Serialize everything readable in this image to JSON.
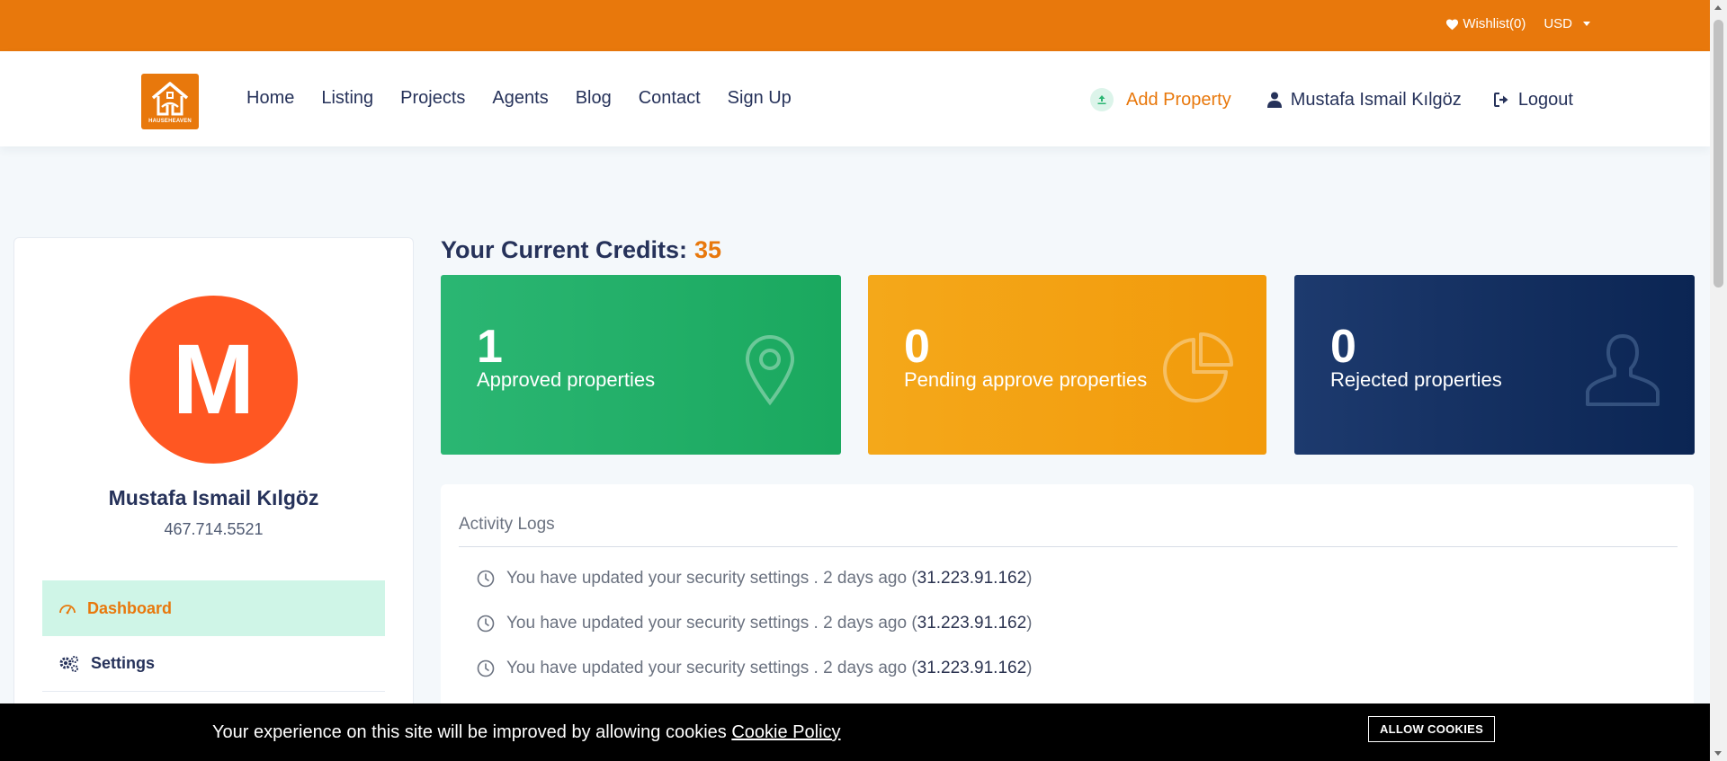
{
  "topbar": {
    "wishlist_label": "Wishlist(0)",
    "currency": "USD"
  },
  "brand": {
    "logo_text": "HAUSEHEAVEN",
    "accent_color": "#e8780c"
  },
  "nav": {
    "links": [
      "Home",
      "Listing",
      "Projects",
      "Agents",
      "Blog",
      "Contact",
      "Sign Up"
    ],
    "add_property": "Add Property",
    "user_name": "Mustafa Ismail Kılgöz",
    "logout": "Logout"
  },
  "profile": {
    "avatar_letter": "M",
    "avatar_color": "#ff5722",
    "name": "Mustafa Ismail Kılgöz",
    "phone": "467.714.5521"
  },
  "sidebar": {
    "items": [
      {
        "label": "Dashboard",
        "icon": "dashboard-icon",
        "active": true
      },
      {
        "label": "Settings",
        "icon": "gears-icon",
        "active": false
      }
    ]
  },
  "credits": {
    "label": "Your Current Credits:",
    "value": "35"
  },
  "stats": [
    {
      "value": "1",
      "label": "Approved properties",
      "icon": "map-pin-icon",
      "color": "#2bb673"
    },
    {
      "value": "0",
      "label": "Pending approve properties",
      "icon": "pie-chart-icon",
      "color": "#f4a81a"
    },
    {
      "value": "0",
      "label": "Rejected properties",
      "icon": "user-icon",
      "color": "#0b2553"
    }
  ],
  "activity": {
    "title": "Activity Logs",
    "logs": [
      {
        "text": "You have updated your security settings . 2 days ago (",
        "ip": "31.223.91.162",
        "close": ")"
      },
      {
        "text": "You have updated your security settings . 2 days ago (",
        "ip": "31.223.91.162",
        "close": ")"
      },
      {
        "text": "You have updated your security settings . 2 days ago (",
        "ip": "31.223.91.162",
        "close": ")"
      }
    ]
  },
  "cookie": {
    "message": "Your experience on this site will be improved by allowing cookies ",
    "policy_link": "Cookie Policy",
    "button": "ALLOW COOKIES"
  }
}
